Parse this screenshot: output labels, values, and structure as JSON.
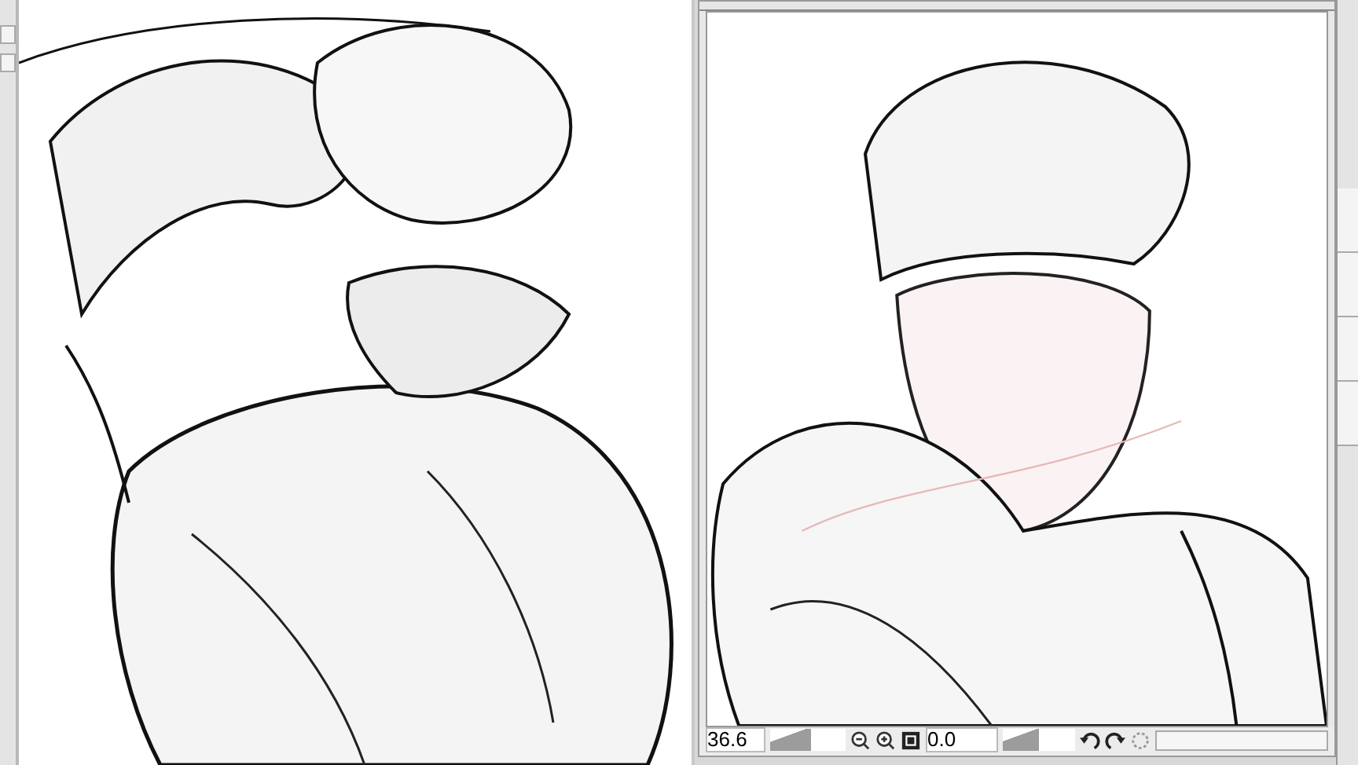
{
  "navigator": {
    "zoom": "36.6",
    "zoom_slider": {
      "level": 0.55
    },
    "rotation": "0.0",
    "rotation_slider": {
      "level": 0.5
    }
  }
}
